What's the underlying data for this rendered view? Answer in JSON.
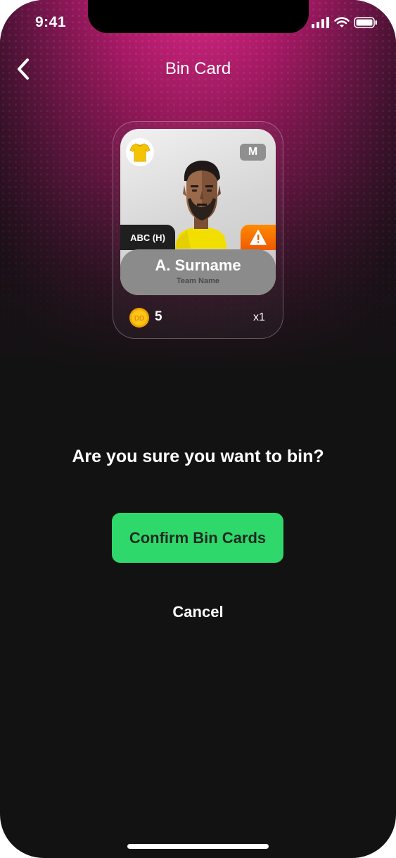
{
  "status_bar": {
    "time": "9:41"
  },
  "header": {
    "title": "Bin Card"
  },
  "card": {
    "position": "M",
    "fixture": "ABC (H)",
    "player_name": "A. Surname",
    "team_name": "Team Name",
    "price": "5",
    "quantity": "x1"
  },
  "dialog": {
    "question": "Are you sure you want to bin?",
    "confirm_label": "Confirm Bin Cards",
    "cancel_label": "Cancel"
  },
  "colors": {
    "accent": "#2fd86a",
    "brand": "#e1298a",
    "background": "#121212",
    "warning": "#f57a00"
  }
}
